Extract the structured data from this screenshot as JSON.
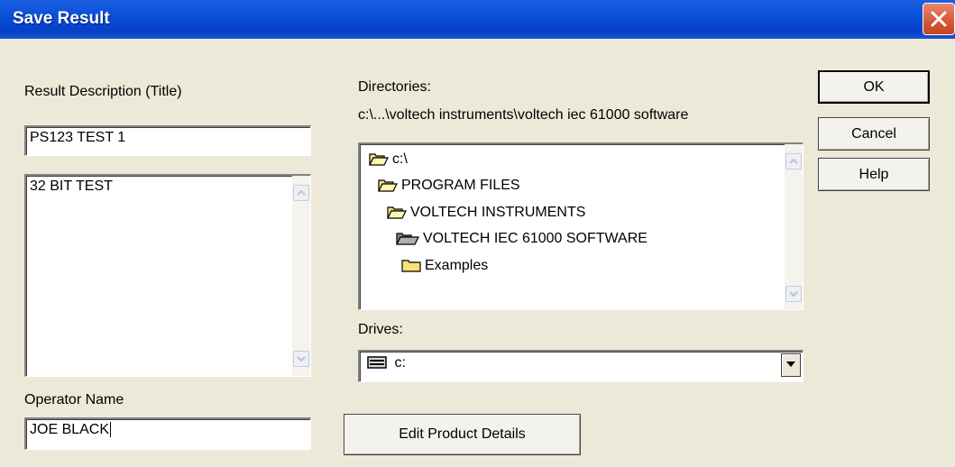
{
  "window": {
    "title": "Save Result"
  },
  "left": {
    "result_label": "Result Description (Title)",
    "title_value": "PS123 TEST 1",
    "description_value": "32 BIT TEST",
    "operator_label": "Operator Name",
    "operator_value": "JOE BLACK"
  },
  "directories": {
    "label": "Directories:",
    "current_path": "c:\\...\\voltech instruments\\voltech iec 61000 software",
    "items": [
      {
        "label": "c:\\",
        "icon": "open-folder-icon"
      },
      {
        "label": "PROGRAM FILES",
        "icon": "open-folder-icon"
      },
      {
        "label": "VOLTECH INSTRUMENTS",
        "icon": "open-folder-icon"
      },
      {
        "label": "VOLTECH IEC 61000 SOFTWARE",
        "icon": "open-folder-selected-icon"
      },
      {
        "label": "Examples",
        "icon": "closed-folder-icon"
      }
    ]
  },
  "drives": {
    "label": "Drives:",
    "selected": "c:",
    "icon": "drive-icon"
  },
  "buttons": {
    "ok": "OK",
    "cancel": "Cancel",
    "help": "Help",
    "edit_product": "Edit Product Details"
  },
  "colors": {
    "titlebar": "#0a4fd8",
    "dialog_bg": "#ece9d8",
    "close": "#d65a3a"
  }
}
